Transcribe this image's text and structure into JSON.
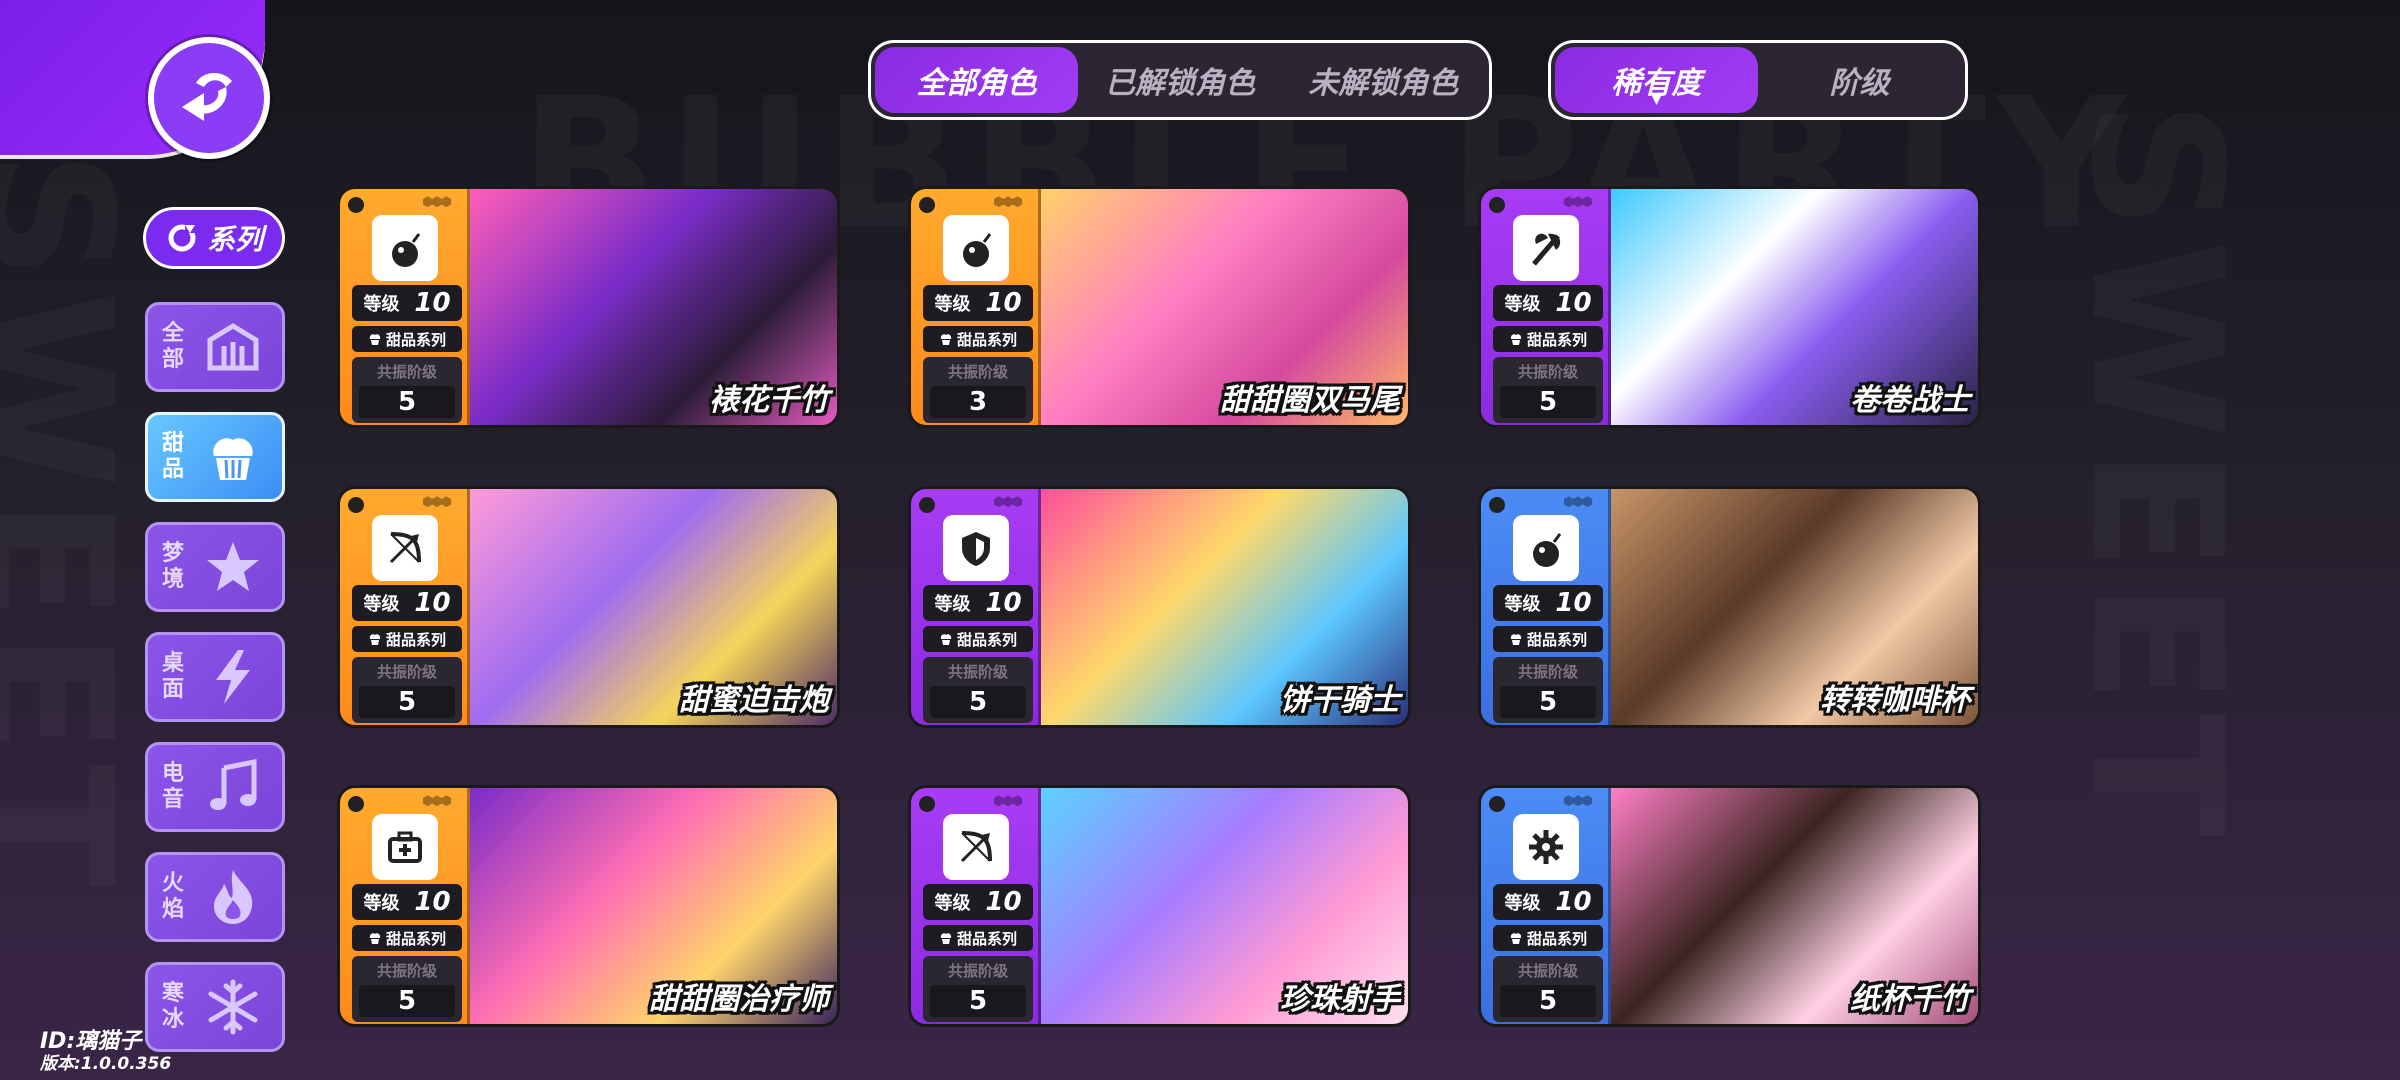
{
  "filters": {
    "character_tabs": [
      {
        "label": "全部角色",
        "active": true
      },
      {
        "label": "已解锁角色",
        "active": false
      },
      {
        "label": "未解锁角色",
        "active": false
      }
    ],
    "sort_tabs": [
      {
        "label": "稀有度",
        "active": true
      },
      {
        "label": "阶级",
        "active": false
      }
    ]
  },
  "sidebar": {
    "series_label": "系列",
    "items": [
      {
        "label": "全部",
        "icon": "building-icon",
        "active": false
      },
      {
        "label": "甜品",
        "icon": "cupcake-icon",
        "active": true
      },
      {
        "label": "梦境",
        "icon": "star-icon",
        "active": false
      },
      {
        "label": "桌面",
        "icon": "lightning-icon",
        "active": false
      },
      {
        "label": "电音",
        "icon": "music-note-icon",
        "active": false
      },
      {
        "label": "火焰",
        "icon": "flame-icon",
        "active": false
      },
      {
        "label": "寒冰",
        "icon": "snowflake-icon",
        "active": false
      }
    ]
  },
  "labels": {
    "level": "等级",
    "series": "甜品系列",
    "resonance": "共振阶级"
  },
  "cards": [
    {
      "name": "裱花千竹",
      "level": "10",
      "resonance": "5",
      "rarity": "orange",
      "role_icon": "bomb-icon"
    },
    {
      "name": "甜甜圈双马尾",
      "level": "10",
      "resonance": "3",
      "rarity": "orange",
      "role_icon": "bomb-icon"
    },
    {
      "name": "卷卷战士",
      "level": "10",
      "resonance": "5",
      "rarity": "purple",
      "role_icon": "axe-icon"
    },
    {
      "name": "甜蜜迫击炮",
      "level": "10",
      "resonance": "5",
      "rarity": "orange",
      "role_icon": "bow-icon"
    },
    {
      "name": "饼干骑士",
      "level": "10",
      "resonance": "5",
      "rarity": "purple",
      "role_icon": "shield-icon"
    },
    {
      "name": "转转咖啡杯",
      "level": "10",
      "resonance": "5",
      "rarity": "blue",
      "role_icon": "bomb-icon"
    },
    {
      "name": "甜甜圈治疗师",
      "level": "10",
      "resonance": "5",
      "rarity": "orange",
      "role_icon": "medkit-icon"
    },
    {
      "name": "珍珠射手",
      "level": "10",
      "resonance": "5",
      "rarity": "purple",
      "role_icon": "bow-icon"
    },
    {
      "name": "纸杯千竹",
      "level": "10",
      "resonance": "5",
      "rarity": "blue",
      "role_icon": "gear-icon"
    }
  ],
  "footer": {
    "id": "ID:璃猫子",
    "version": "版本:1.0.0.356"
  },
  "colors": {
    "orange": "#ff9a22",
    "purple": "#9a33ec",
    "blue": "#4580ee",
    "accent": "#8a2be2"
  }
}
